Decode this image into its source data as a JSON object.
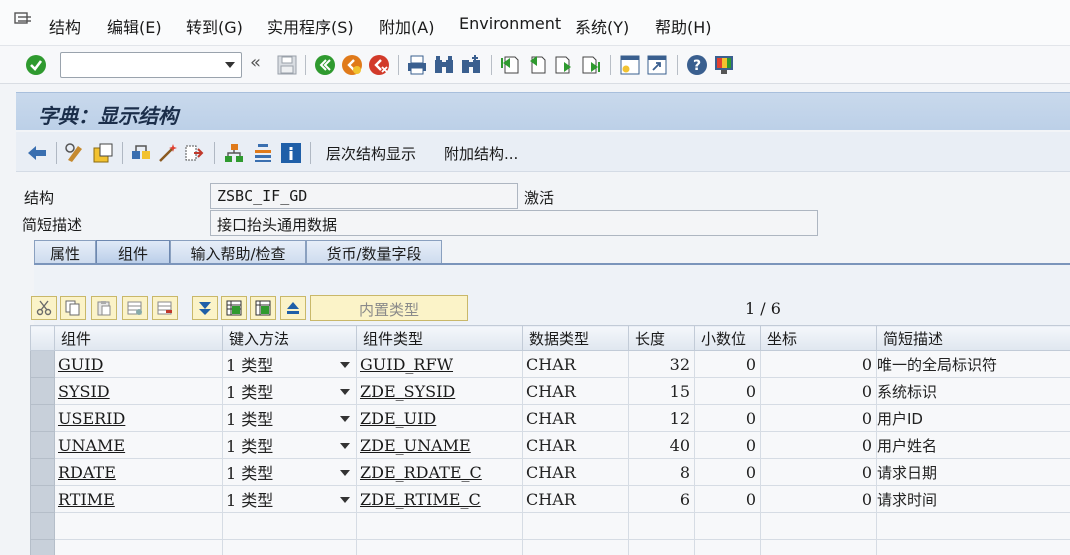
{
  "menu": {
    "items": [
      "结构",
      "编辑(E)",
      "转到(G)",
      "实用程序(S)",
      "附加(A)",
      "Environment",
      "系统(Y)",
      "帮助(H)"
    ]
  },
  "toolbar": {
    "command_value": "",
    "collapse_glyph": "«",
    "icons": [
      "enter-check-icon",
      "save-icon",
      "back-icon",
      "exit-icon",
      "cancel-icon",
      "print-icon",
      "find-icon",
      "find-next-icon",
      "first-page-icon",
      "previous-page-icon",
      "next-page-icon",
      "last-page-icon",
      "new-session-icon",
      "shortcut-icon",
      "help-icon",
      "customize-layout-icon"
    ]
  },
  "title": "字典：显示结构",
  "app_toolbar": {
    "hierarchy_label": "层次结构显示",
    "append_label": "附加结构..."
  },
  "header": {
    "structure_label": "结构",
    "structure_value": "ZSBC_IF_GD",
    "status": "激活",
    "desc_label": "简短描述",
    "desc_value": "接口抬头通用数据"
  },
  "tabs": [
    "属性",
    "组件",
    "输入帮助/检查",
    "货币/数量字段"
  ],
  "active_tab": "组件",
  "table_toolbar": {
    "builtin_type_label": "内置类型",
    "pager": "1 / 6"
  },
  "grid": {
    "columns": [
      "组件",
      "键入方法",
      "组件类型",
      "数据类型",
      "长度",
      "小数位",
      "坐标",
      "简短描述"
    ],
    "rows": [
      {
        "component": "GUID",
        "typing": "1 类型",
        "comp_type": "GUID_RFW",
        "data_type": "CHAR",
        "length": "32",
        "decimals": "0",
        "coord": "0",
        "desc": "唯一的全局标识符"
      },
      {
        "component": "SYSID",
        "typing": "1 类型",
        "comp_type": "ZDE_SYSID",
        "data_type": "CHAR",
        "length": "15",
        "decimals": "0",
        "coord": "0",
        "desc": "系统标识"
      },
      {
        "component": "USERID",
        "typing": "1 类型",
        "comp_type": "ZDE_UID",
        "data_type": "CHAR",
        "length": "12",
        "decimals": "0",
        "coord": "0",
        "desc": "用户ID"
      },
      {
        "component": "UNAME",
        "typing": "1 类型",
        "comp_type": "ZDE_UNAME",
        "data_type": "CHAR",
        "length": "40",
        "decimals": "0",
        "coord": "0",
        "desc": "用户姓名"
      },
      {
        "component": "RDATE",
        "typing": "1 类型",
        "comp_type": "ZDE_RDATE_C",
        "data_type": "CHAR",
        "length": "8",
        "decimals": "0",
        "coord": "0",
        "desc": "请求日期"
      },
      {
        "component": "RTIME",
        "typing": "1 类型",
        "comp_type": "ZDE_RTIME_C",
        "data_type": "CHAR",
        "length": "6",
        "decimals": "0",
        "coord": "0",
        "desc": "请求时间"
      }
    ]
  },
  "colors": {
    "title_band": "#c9d9ec",
    "tab_line": "#7b95bb",
    "table_button": "#fbf3c8",
    "ok_green": "#2f9a2f",
    "exit_orange": "#e07a1a",
    "cancel_red": "#d23a2a"
  }
}
